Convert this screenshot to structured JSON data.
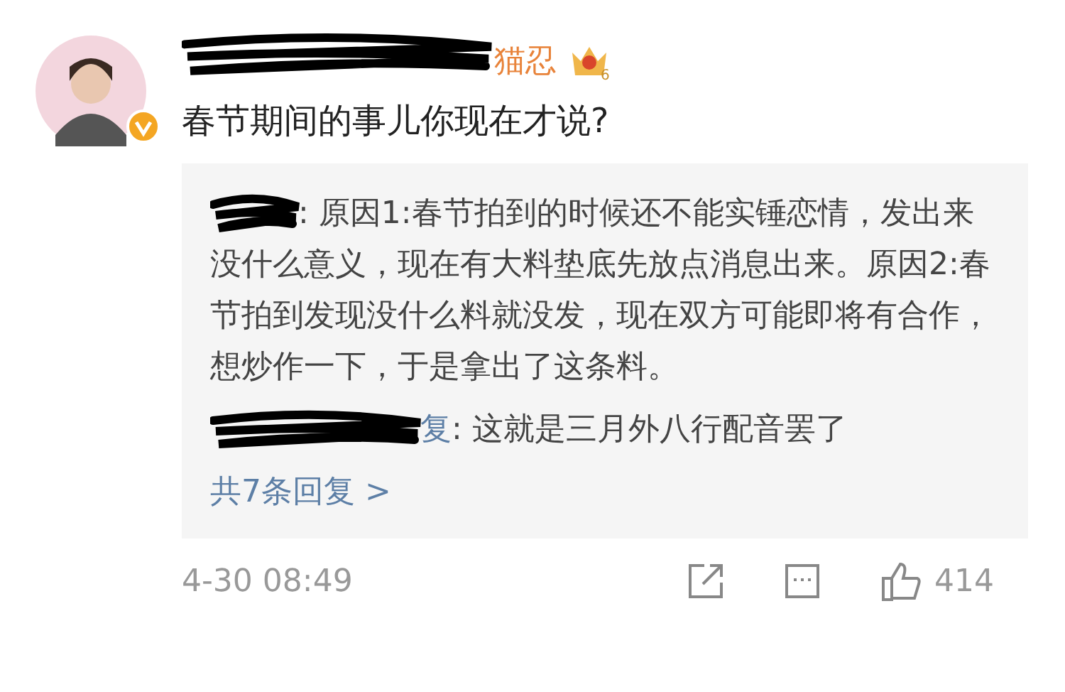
{
  "comment": {
    "author_visible": "猫忍",
    "level_badge": "6",
    "text": "春节期间的事儿你现在才说?",
    "replies": [
      {
        "text": ": 原因1:春节拍到的时候还不能实锤恋情，发出来没什么意义，现在有大料垫底先放点消息出来。原因2:春节拍到发现没什么料就没发，现在双方可能即将有合作，想炒作一下，于是拿出了这条料。"
      },
      {
        "author_tail": "复",
        "text": ": 这就是三月外八行配音罢了"
      }
    ],
    "more_replies": "共7条回复 >",
    "time": "4-30 08:49",
    "likes": "414"
  }
}
